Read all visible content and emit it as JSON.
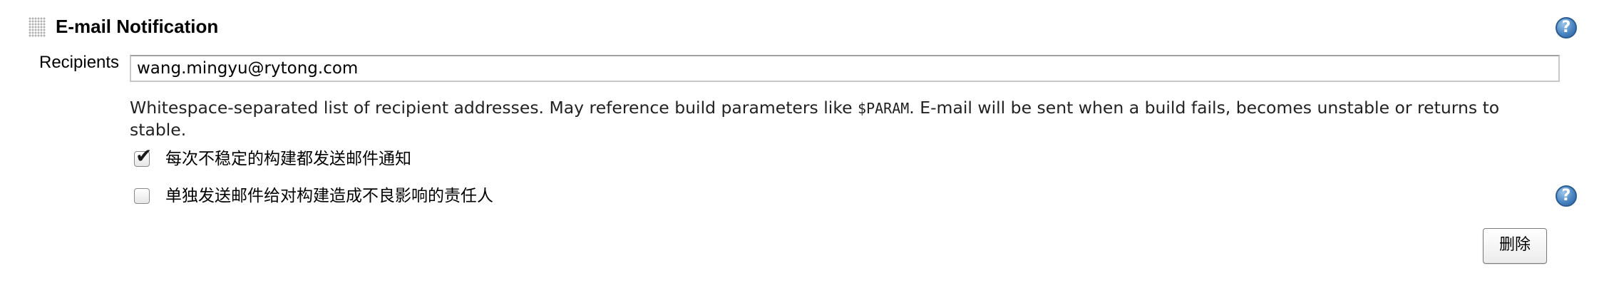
{
  "section": {
    "title": "E-mail Notification",
    "help_icon": "?",
    "drag_handle_icon": "drag-handle-icon"
  },
  "recipients": {
    "label": "Recipients",
    "value": "wang.mingyu@rytong.com"
  },
  "help_text": {
    "before_param": "Whitespace-separated list of recipient addresses. May reference build parameters like ",
    "param": "$PARAM",
    "after_param": ". E-mail will be sent when a build fails, becomes unstable or returns to stable."
  },
  "options": [
    {
      "label": "每次不稳定的构建都发送邮件通知",
      "checked": true,
      "check_glyph": "✔"
    },
    {
      "label": "单独发送邮件给对构建造成不良影响的责任人",
      "checked": false,
      "check_glyph": ""
    }
  ],
  "second_help_icon": "?",
  "delete_button": {
    "label": "删除"
  },
  "colors": {
    "help_icon": "#4a86c3",
    "input_border": "#c8c8c8",
    "button_border": "#7a7a7a"
  }
}
